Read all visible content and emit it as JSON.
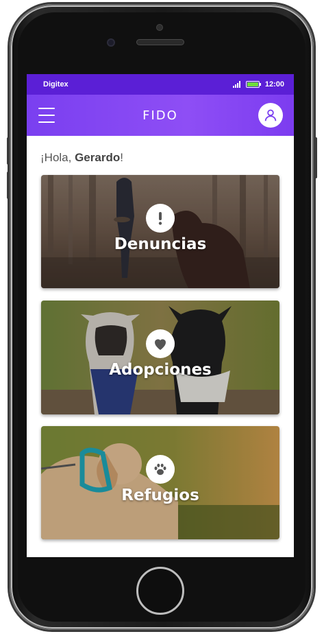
{
  "status_bar": {
    "carrier": "Digitex",
    "time": "12:00"
  },
  "app_bar": {
    "title": "FIDO",
    "menu_icon": "hamburger-menu-icon",
    "profile_icon": "user-profile-icon"
  },
  "greeting": {
    "prefix": "¡Hola, ",
    "name": "Gerardo",
    "suffix": "!"
  },
  "cards": [
    {
      "label": "Denuncias",
      "icon": "exclamation-icon"
    },
    {
      "label": "Adopciones",
      "icon": "heart-icon"
    },
    {
      "label": "Refugios",
      "icon": "paw-icon"
    }
  ],
  "colors": {
    "status_bar": "#5b1fd6",
    "app_bar": "#8347f2",
    "card_icon": "#555555"
  }
}
